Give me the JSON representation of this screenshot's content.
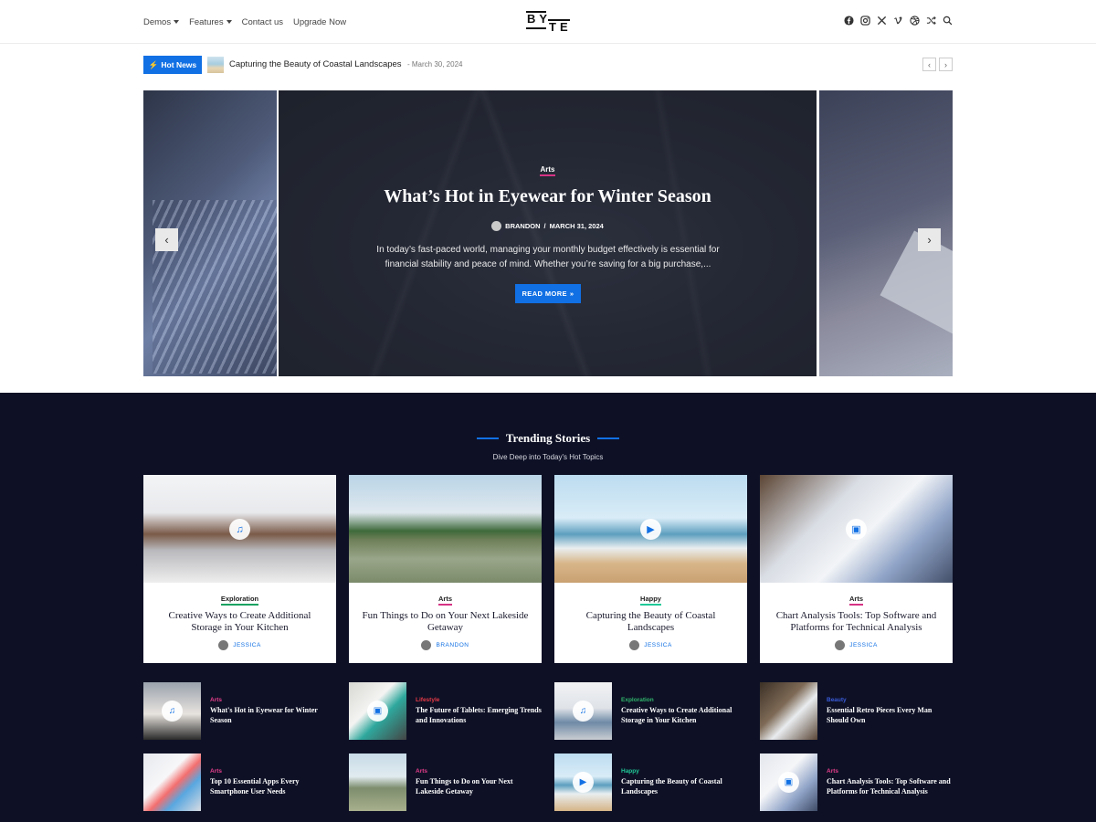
{
  "nav": {
    "items": [
      {
        "label": "Demos",
        "has_caret": true
      },
      {
        "label": "Features",
        "has_caret": true
      },
      {
        "label": "Contact us",
        "has_caret": false
      },
      {
        "label": "Upgrade Now",
        "has_caret": false
      }
    ]
  },
  "logo": {
    "top": "BY",
    "bottom": "TE"
  },
  "socials": [
    "facebook-icon",
    "instagram-icon",
    "x-icon",
    "vimeo-icon",
    "dribbble-icon",
    "shuffle-icon",
    "search-icon"
  ],
  "hot_news": {
    "badge": "Hot News",
    "title": "Capturing the Beauty of Coastal Landscapes",
    "date": "- March 30, 2024"
  },
  "slider": {
    "category": "Arts",
    "title": "What’s Hot in Eyewear for Winter Season",
    "author": "BRANDON",
    "separator": "/",
    "date": "MARCH 31, 2024",
    "excerpt": "In today’s fast-paced world, managing your monthly budget effectively is essential for financial stability and peace of mind. Whether you’re saving for a big purchase,...",
    "read_more": "READ MORE"
  },
  "trending": {
    "title": "Trending Stories",
    "subtitle": "Dive Deep into Today's Hot Topics",
    "cards": [
      {
        "category": "Exploration",
        "cat_color": "#1aa260",
        "title": "Creative Ways to Create Additional Storage in Your Kitchen",
        "author": "JESSICA",
        "icon": "music-icon",
        "icon_glyph": "♫"
      },
      {
        "category": "Arts",
        "cat_color": "#d63384",
        "title": "Fun Things to Do on Your Next Lakeside Getaway",
        "author": "BRANDON",
        "icon": "",
        "icon_glyph": ""
      },
      {
        "category": "Happy",
        "cat_color": "#20c997",
        "title": "Capturing the Beauty of Coastal Landscapes",
        "author": "JESSICA",
        "icon": "play-icon",
        "icon_glyph": "▶"
      },
      {
        "category": "Arts",
        "cat_color": "#d63384",
        "title": "Chart Analysis Tools: Top Software and Platforms for Technical Analysis",
        "author": "JESSICA",
        "icon": "gallery-icon",
        "icon_glyph": "▣"
      }
    ],
    "small": [
      {
        "category": "Arts",
        "cat_color": "#e83e8c",
        "title": "What's Hot in Eyewear for Winter Season",
        "icon": "music-icon",
        "icon_glyph": "♫"
      },
      {
        "category": "Lifestyle",
        "cat_color": "#e63946",
        "title": "The Future of Tablets: Emerging Trends and Innovations",
        "icon": "gallery-icon",
        "icon_glyph": "▣"
      },
      {
        "category": "Exploration",
        "cat_color": "#2fb36a",
        "title": "Creative Ways to Create Additional Storage in Your Kitchen",
        "icon": "music-icon",
        "icon_glyph": "♫"
      },
      {
        "category": "Beauty",
        "cat_color": "#3a5bd9",
        "title": "Essential Retro Pieces Every Man Should Own",
        "icon": "",
        "icon_glyph": ""
      },
      {
        "category": "Arts",
        "cat_color": "#e83e8c",
        "title": "Top 10 Essential Apps Every Smartphone User Needs",
        "icon": "",
        "icon_glyph": ""
      },
      {
        "category": "Arts",
        "cat_color": "#e83e8c",
        "title": "Fun Things to Do on Your Next Lakeside Getaway",
        "icon": "",
        "icon_glyph": ""
      },
      {
        "category": "Happy",
        "cat_color": "#20c997",
        "title": "Capturing the Beauty of Coastal Landscapes",
        "icon": "play-icon",
        "icon_glyph": "▶"
      },
      {
        "category": "Arts",
        "cat_color": "#e83e8c",
        "title": "Chart Analysis Tools: Top Software and Platforms for Technical Analysis",
        "icon": "gallery-icon",
        "icon_glyph": "▣"
      }
    ]
  },
  "colors": {
    "accent": "#1170e4",
    "dark_bg": "#0e1126"
  }
}
